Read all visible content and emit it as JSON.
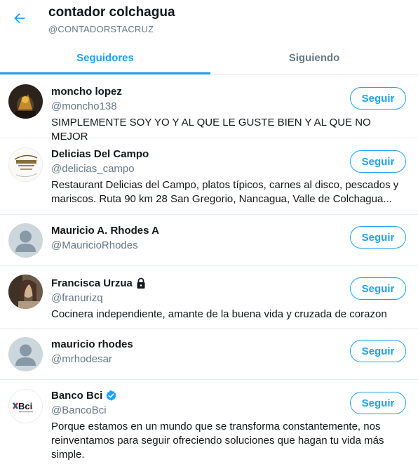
{
  "header": {
    "title": "contador colchagua",
    "handle": "@CONTADORSTACRUZ",
    "back_icon": "arrow-left-icon"
  },
  "tabs": [
    {
      "label": "Seguidores",
      "active": true
    },
    {
      "label": "Siguiendo",
      "active": false
    }
  ],
  "colors": {
    "accent": "#1da1f2",
    "text_primary": "#14171a",
    "text_secondary": "#657786",
    "divider": "#e6ecf0"
  },
  "users": [
    {
      "name": "moncho lopez",
      "handle": "@moncho138",
      "bio": "SIMPLEMENTE SOY YO Y AL QUE LE GUSTE BIEN Y AL QUE NO MEJOR",
      "follow_label": "Seguir",
      "avatar": "photo-avatar-dark"
    },
    {
      "name": "Delicias Del Campo",
      "handle": "@delicias_campo",
      "bio": "Restaurant Delicias del Campo, platos típicos, carnes al disco, pescados y mariscos. Ruta 90 km 28 San Gregorio, Nancagua, Valle de Colchagua...",
      "follow_label": "Seguir",
      "avatar": "restaurant-logo-avatar"
    },
    {
      "name": "Mauricio A. Rhodes A",
      "handle": "@MauricioRhodes",
      "bio": "",
      "follow_label": "Seguir",
      "avatar": "default-avatar"
    },
    {
      "name": "Francisca Urzua",
      "handle": "@franurizq",
      "bio": "Cocinera independiente, amante de la buena vida y cruzada de corazon",
      "follow_label": "Seguir",
      "avatar": "photo-avatar-portrait",
      "badge": "lock-icon"
    },
    {
      "name": "mauricio rhodes",
      "handle": "@mrhodesar",
      "bio": "",
      "follow_label": "Seguir",
      "avatar": "default-avatar"
    },
    {
      "name": "Banco Bci",
      "handle": "@BancoBci",
      "bio": "Porque estamos en un mundo que se transforma constantemente, nos reinventamos para seguir ofreciendo soluciones que hagan tu vida más simple.",
      "follow_label": "Seguir",
      "avatar": "bci-logo-avatar",
      "badge": "verified-badge-icon"
    }
  ]
}
